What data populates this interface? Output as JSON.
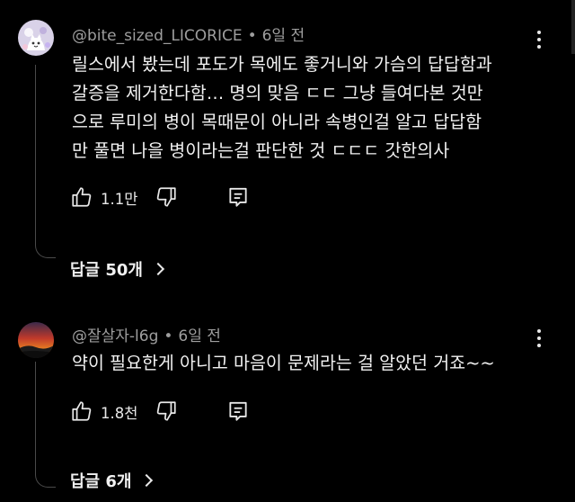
{
  "comments": [
    {
      "author": "@bite_sized_LICORICE",
      "separator": "•",
      "time": "6일 전",
      "lines": [
        "릴스에서 봤는데 포도가 목에도 좋거니와 가슴의 답답함과",
        "갈증을 제거한다함… 명의 맞음 ㄷㄷ 그냥 들여다본 것만",
        "으로 루미의 병이 목때문이 아니라 속병인걸 알고 답답함",
        "만 풀면 나을 병이라는걸 판단한 것 ㄷㄷㄷ 갓한의사"
      ],
      "likes": "1.1만",
      "replies": "답글 50개",
      "avatar_icon": "cartoon-cat-avatar",
      "avatar_bg": "#d7d0e6"
    },
    {
      "author": "@잘살자-l6g",
      "separator": "•",
      "time": "6일 전",
      "lines": [
        "약이 필요한게 아니고 마음이 문제라는 걸 알았던 거죠~~"
      ],
      "likes": "1.8천",
      "replies": "답글 6개",
      "avatar_icon": "sunset-landscape-avatar",
      "avatar_bg": "#c0392b"
    }
  ],
  "icons": {
    "like": "thumbs-up-icon",
    "dislike": "thumbs-down-icon",
    "reply": "comment-reply-icon",
    "more": "more-vertical-icon",
    "chevron": "chevron-right-icon"
  },
  "colors": {
    "background": "#000000",
    "text": "#f1f1f1",
    "meta": "#9e9e9e",
    "thread_line": "#4a4a4a"
  }
}
